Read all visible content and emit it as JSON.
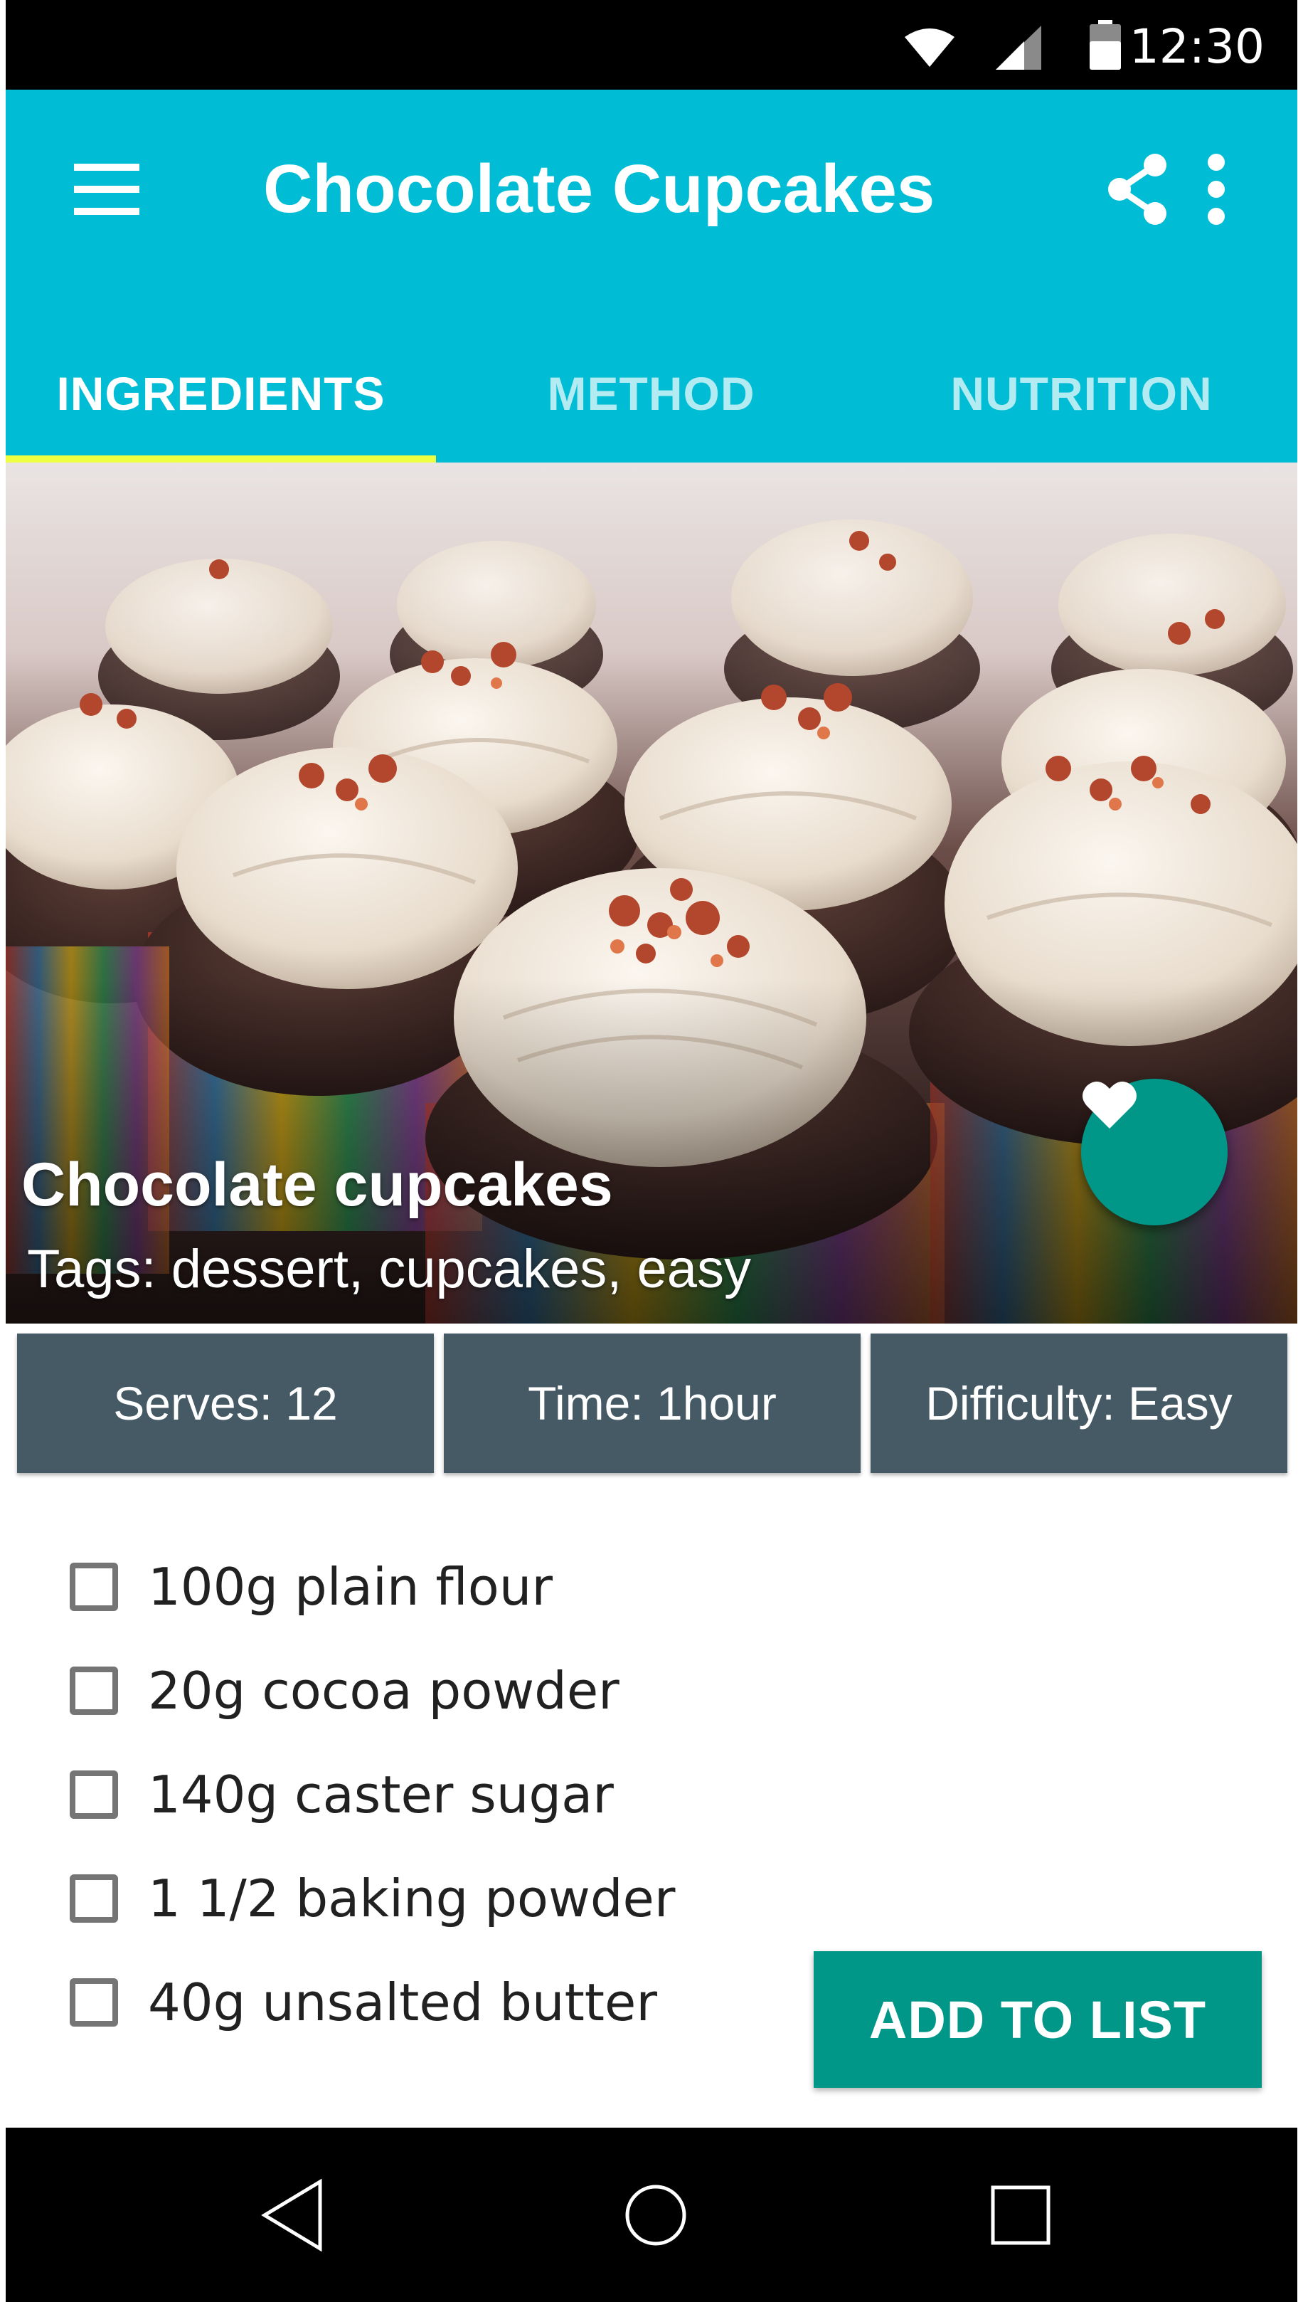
{
  "status_bar": {
    "time": "12:30",
    "icons": [
      "wifi-icon",
      "signal-icon",
      "battery-icon"
    ]
  },
  "app_bar": {
    "title": "Chocolate Cupcakes",
    "icons": [
      "menu-icon",
      "share-icon",
      "more-vert-icon"
    ],
    "background_color": "#00bcd4"
  },
  "tabs": [
    {
      "label": "INGREDIENTS",
      "active": true
    },
    {
      "label": "METHOD",
      "active": false
    },
    {
      "label": "NUTRITION",
      "active": false
    }
  ],
  "hero": {
    "title": "Chocolate cupcakes",
    "tags": "Tags: dessert, cupcakes, easy",
    "fab_icon": "heart-icon"
  },
  "info": {
    "serves": "Serves: 12",
    "time": "Time: 1hour",
    "difficulty": "Difficulty: Easy"
  },
  "ingredients": [
    {
      "label": "100g plain flour",
      "checked": false
    },
    {
      "label": "20g cocoa powder",
      "checked": false
    },
    {
      "label": "140g caster sugar",
      "checked": false
    },
    {
      "label": "1 1/2 baking powder",
      "checked": false
    },
    {
      "label": "40g unsalted butter",
      "checked": false
    }
  ],
  "actions": {
    "add_to_list": "ADD TO LIST"
  },
  "nav_bar": {
    "icons": [
      "back-icon",
      "home-icon",
      "recents-icon"
    ]
  },
  "colors": {
    "primary": "#00bcd4",
    "accent": "#009688",
    "tab_indicator": "#eeff41",
    "chip": "#455a64"
  }
}
